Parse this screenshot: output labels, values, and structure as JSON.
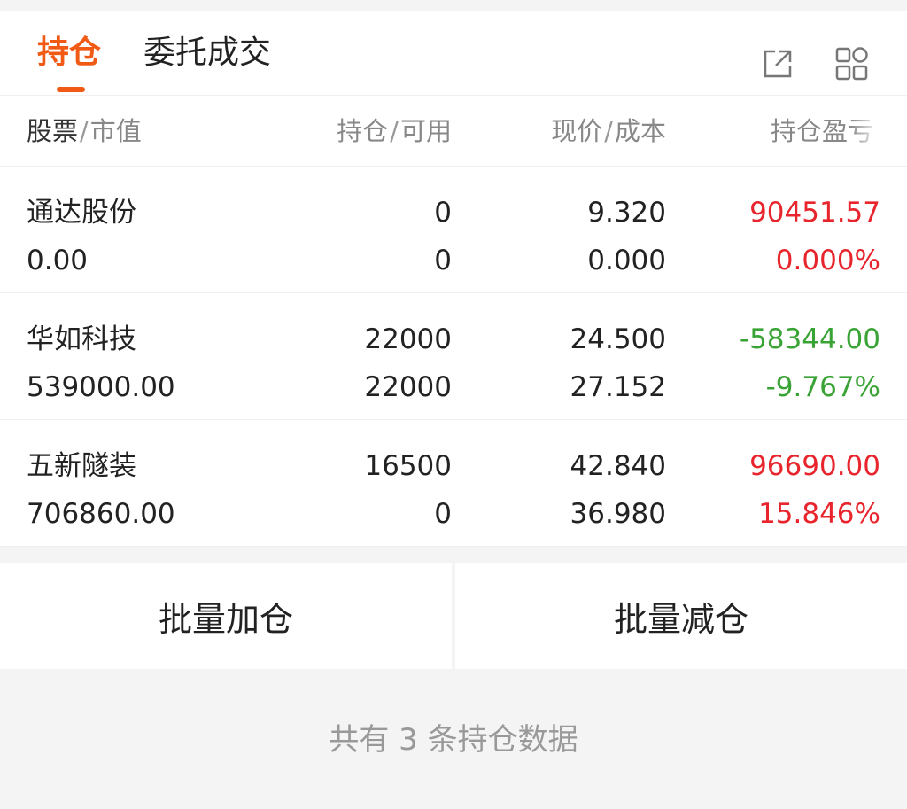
{
  "tabs": [
    {
      "label": "持仓",
      "active": true
    },
    {
      "label": "委托成交",
      "active": false
    }
  ],
  "header_icons": [
    "share-icon",
    "grid-icon"
  ],
  "columns": [
    {
      "main": "股票",
      "sub": "市值"
    },
    {
      "main": "持仓",
      "sub": "可用"
    },
    {
      "main": "现价",
      "sub": "成本"
    },
    {
      "main": "持仓盈亏",
      "sub": ""
    }
  ],
  "holdings": [
    {
      "name": "通达股份",
      "market_value": "0.00",
      "position": "0",
      "available": "0",
      "price": "9.320",
      "cost": "0.000",
      "pl": "90451.57",
      "pl_pct": "0.000%",
      "direction": "up"
    },
    {
      "name": "华如科技",
      "market_value": "539000.00",
      "position": "22000",
      "available": "22000",
      "price": "24.500",
      "cost": "27.152",
      "pl": "-58344.00",
      "pl_pct": "-9.767%",
      "direction": "down"
    },
    {
      "name": "五新隧装",
      "market_value": "706860.00",
      "position": "16500",
      "available": "0",
      "price": "42.840",
      "cost": "36.980",
      "pl": "96690.00",
      "pl_pct": "15.846%",
      "direction": "up"
    }
  ],
  "buttons": {
    "batch_add": "批量加仓",
    "batch_reduce": "批量减仓"
  },
  "footer": "共有 3 条持仓数据",
  "colors": {
    "accent": "#f05a14",
    "up": "#e8242c",
    "down": "#3aa335"
  }
}
